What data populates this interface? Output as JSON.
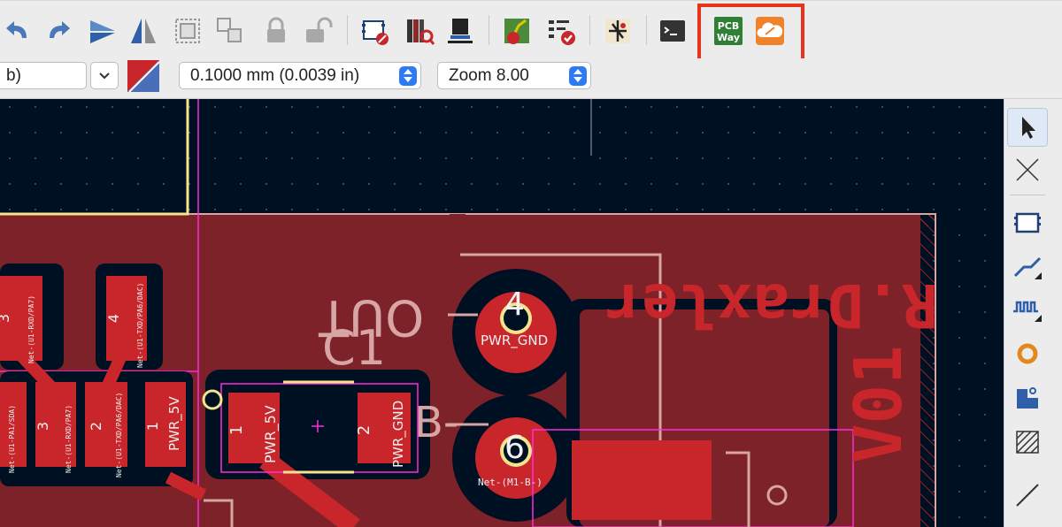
{
  "toolbar": {
    "buttons": [
      {
        "name": "undo-icon"
      },
      {
        "name": "redo-icon"
      },
      {
        "name": "flip-icon"
      },
      {
        "name": "mirror-icon"
      },
      {
        "name": "group-icon"
      },
      {
        "name": "ungroup-icon"
      },
      {
        "name": "lock-icon"
      },
      {
        "name": "unlock-icon"
      },
      {
        "name": "footprint-editor-icon"
      },
      {
        "name": "footprint-browser-icon"
      },
      {
        "name": "update-pcb-icon"
      },
      {
        "name": "route-icon"
      },
      {
        "name": "drc-icon"
      },
      {
        "name": "schematic-icon"
      },
      {
        "name": "scripting-console-icon"
      },
      {
        "name": "pcbway-icon"
      },
      {
        "name": "cloud-icon"
      }
    ],
    "pcbway_line1": "PCB",
    "pcbway_line2": "Way"
  },
  "toolbar2": {
    "layer_value": "b)",
    "grid_value": "0.1000 mm (0.0039 in)",
    "zoom_value": "Zoom 8.00"
  },
  "pcb": {
    "silk_name": "R.Draxler",
    "silk_version": "V01",
    "pad4_number": "4",
    "pad4_net": "PWR_GND",
    "pad6_number": "6",
    "pad6_net": "Net-(M1-B-)",
    "label_out": "OUT",
    "label_c1": "C1",
    "label_b": "B-",
    "c1_pad1_num": "1",
    "c1_pad1_net": "PWR_5V",
    "c1_pad2_num": "2",
    "c1_pad2_net": "PWR_GND",
    "conn_top": [
      {
        "num": "3",
        "net": "Net-(U1-RXD/PA7)"
      },
      {
        "num": "4",
        "net": "Net-(U1-TXD/PA6/DAC)"
      }
    ],
    "conn_bottom": [
      {
        "num": "3",
        "net": "Net-(U1-RXD/PA7)"
      },
      {
        "num": "2",
        "net": "Net-(U1-TXD/PA6/DAC)"
      },
      {
        "num": "1",
        "net": "PWR_5V"
      }
    ],
    "conn_left_net": "Net-(U1-PA1/SDA)"
  },
  "colors": {
    "board_bg": "#001023",
    "copper": "#c8262a",
    "fill_zone": "#7d2228",
    "edge": "#d8a5a5",
    "courtyard": "#ff2bd9",
    "highlight": "#e8321e"
  }
}
